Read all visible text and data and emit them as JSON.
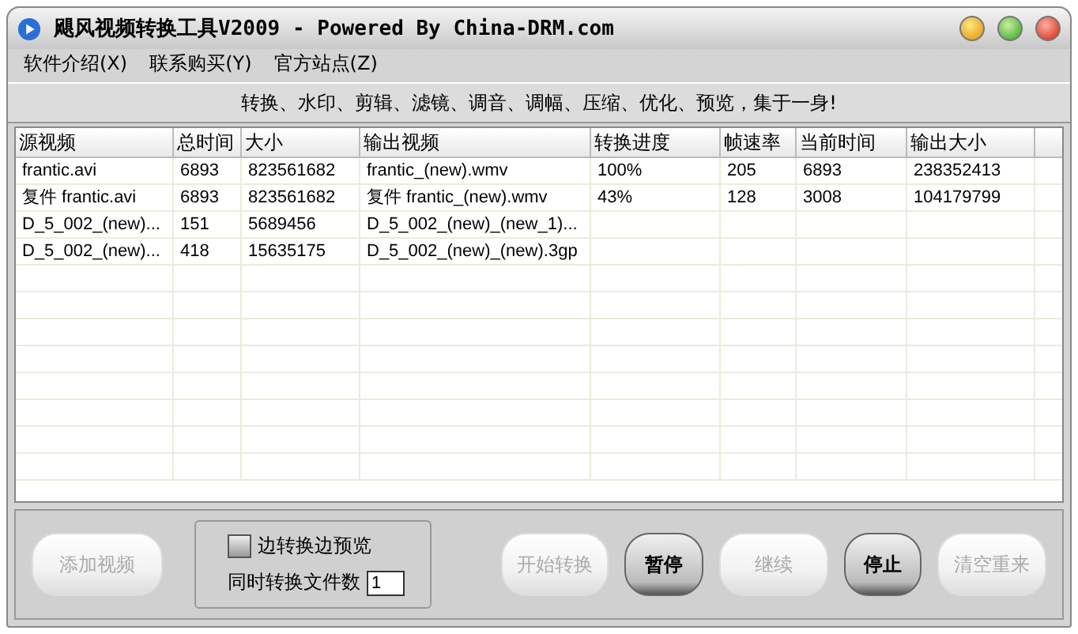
{
  "window": {
    "title": "飓风视频转换工具V2009 - Powered By China-DRM.com"
  },
  "menu": [
    "软件介绍(X)",
    "联系购买(Y)",
    "官方站点(Z)"
  ],
  "banner": "转换、水印、剪辑、滤镜、调音、调幅、压缩、优化、预览，集于一身!",
  "table": {
    "columns": [
      "源视频",
      "总时间",
      "大小",
      "输出视频",
      "转换进度",
      "帧速率",
      "当前时间",
      "输出大小"
    ],
    "rows": [
      [
        "frantic.avi",
        "6893",
        "823561682",
        "frantic_(new).wmv",
        "100%",
        "205",
        "6893",
        "238352413"
      ],
      [
        "复件 frantic.avi",
        "6893",
        "823561682",
        "复件 frantic_(new).wmv",
        "43%",
        "128",
        "3008",
        "104179799"
      ],
      [
        "D_5_002_(new)...",
        "151",
        "5689456",
        "D_5_002_(new)_(new_1)...",
        "",
        "",
        "",
        ""
      ],
      [
        "D_5_002_(new)...",
        "418",
        "15635175",
        "D_5_002_(new)_(new).3gp",
        "",
        "",
        "",
        ""
      ]
    ]
  },
  "add_button": {
    "label": "添加视频",
    "disabled": true
  },
  "options": {
    "preview_checkbox": {
      "label": "边转换边预览",
      "checked": false
    },
    "concurrent": {
      "label": "同时转换文件数",
      "value": "1"
    }
  },
  "buttons": [
    {
      "label": "开始转换",
      "disabled": true
    },
    {
      "label": "暂停",
      "disabled": false
    },
    {
      "label": "继续",
      "disabled": true
    },
    {
      "label": "停止",
      "disabled": false
    },
    {
      "label": "清空重来",
      "disabled": true
    }
  ]
}
